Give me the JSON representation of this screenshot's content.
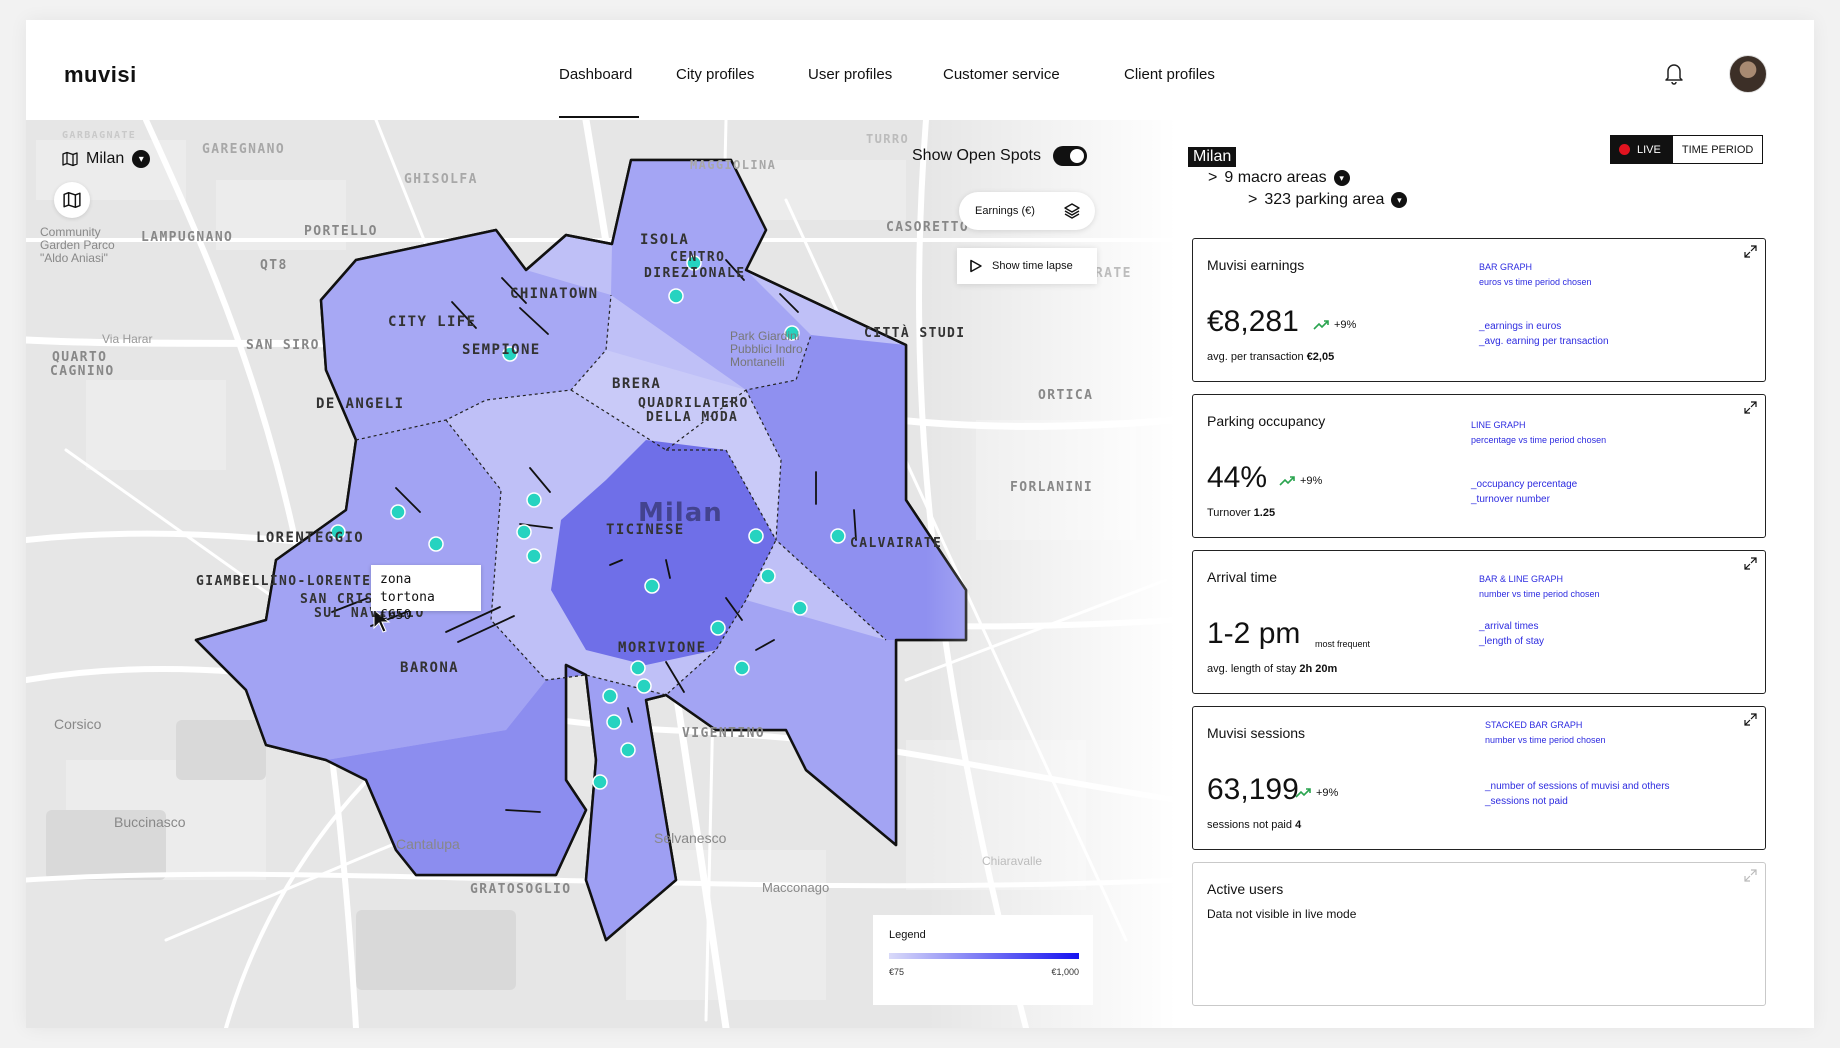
{
  "app": {
    "logo": "muvisi"
  },
  "nav": {
    "items": [
      {
        "label": "Dashboard",
        "active": true
      },
      {
        "label": "City profiles"
      },
      {
        "label": "User profiles"
      },
      {
        "label": "Customer service"
      },
      {
        "label": "Client profiles"
      }
    ]
  },
  "map": {
    "city": "Milan",
    "open_spots_label": "Show Open Spots",
    "open_spots_on": true,
    "layer_label": "Earnings (€)",
    "timelapse_label": "Show time lapse",
    "tooltip": {
      "zone": "zona tortona",
      "value": "€650"
    },
    "legend": {
      "title": "Legend",
      "min": "€75",
      "max": "€1,000",
      "color_low": "#d9daf9",
      "color_high": "#1512f0"
    },
    "labels": {
      "city_center": "Milan",
      "places": [
        "GARBAGNATE",
        "GAREGNANO",
        "GHISOLFA",
        "MAGGIOLINA",
        "TURRO",
        "LAMPUGNANO",
        "PORTELLO",
        "QT8",
        "ISOLA",
        "CENTRO",
        "DIREZIONALE",
        "CASORETTO",
        "CHINATOWN",
        "CITY LIFE",
        "SEMPIONE",
        "LAMBRATE",
        "SAN SIRO",
        "QUARTO",
        "CAGNINO",
        "CITTÀ STUDI",
        "BRERA",
        "QUADRILATERO",
        "DELLA MODA",
        "DE ANGELI",
        "ORTICA",
        "FORLANINI",
        "TICINESE",
        "LORENTEGGIO",
        "CALVAIRATE",
        "GIAMBELLINO-LORENTEGGIO",
        "SAN CRISTOFORO",
        "SUL NAVIGLIO",
        "BARONA",
        "MORIVIONE",
        "VIGENTINO",
        "Corsico",
        "Buccinasco",
        "Cantalupa",
        "Selvanesco",
        "Chiaravalle",
        "GRATOSOGLIO",
        "Macconago",
        "Community Garden Parco \"Aldo Aniasi\"",
        "Via Harar",
        "Park Giardini Pubblici Indro Montanelli"
      ]
    }
  },
  "panel": {
    "region": "Milan",
    "macro_areas": "9 macro areas",
    "parking_areas": "323 parking area",
    "mode": {
      "live": "LIVE",
      "period": "TIME PERIOD",
      "selected": "LIVE"
    },
    "cards": [
      {
        "title": "Muvisi earnings",
        "value": "€8,281",
        "trend": "+9%",
        "note_label": "avg. per transaction",
        "note_value": "€2,05",
        "meta_type": "BAR GRAPH",
        "meta_desc": "euros vs time period chosen",
        "lines": [
          "_earnings in euros",
          "_avg. earning per transaction"
        ]
      },
      {
        "title": "Parking occupancy",
        "value": "44%",
        "trend": "+9%",
        "note_label": "Turnover",
        "note_value": "1.25",
        "meta_type": "LINE GRAPH",
        "meta_desc": "percentage vs time period chosen",
        "lines": [
          "_occupancy percentage",
          "_turnover number"
        ]
      },
      {
        "title": "Arrival time",
        "value": "1-2 pm",
        "sub": "most frequent",
        "note_label": "avg. length of stay",
        "note_value": "2h 20m",
        "meta_type": "BAR & LINE GRAPH",
        "meta_desc": "number vs time period chosen",
        "lines": [
          "_arrival times",
          "_length of stay"
        ]
      },
      {
        "title": "Muvisi sessions",
        "value": "63,199",
        "trend": "+9%",
        "note_label": "sessions not paid",
        "note_value": "4",
        "meta_type": "STACKED BAR GRAPH",
        "meta_desc": "number vs time period chosen",
        "lines": [
          "_number of sessions of muvisi and others",
          "_sessions not paid"
        ]
      },
      {
        "title": "Active users",
        "message": "Data not visible in live mode"
      }
    ]
  },
  "colors": {
    "accent_blue": "#2d2be0",
    "trend_green": "#2aa44f",
    "live_red": "#e1131f",
    "spot_teal": "#26d3c0"
  },
  "icons": [
    "map-icon",
    "chevron-down-icon",
    "layers-icon",
    "play-icon",
    "bell-icon",
    "expand-icon",
    "trend-up-icon"
  ]
}
